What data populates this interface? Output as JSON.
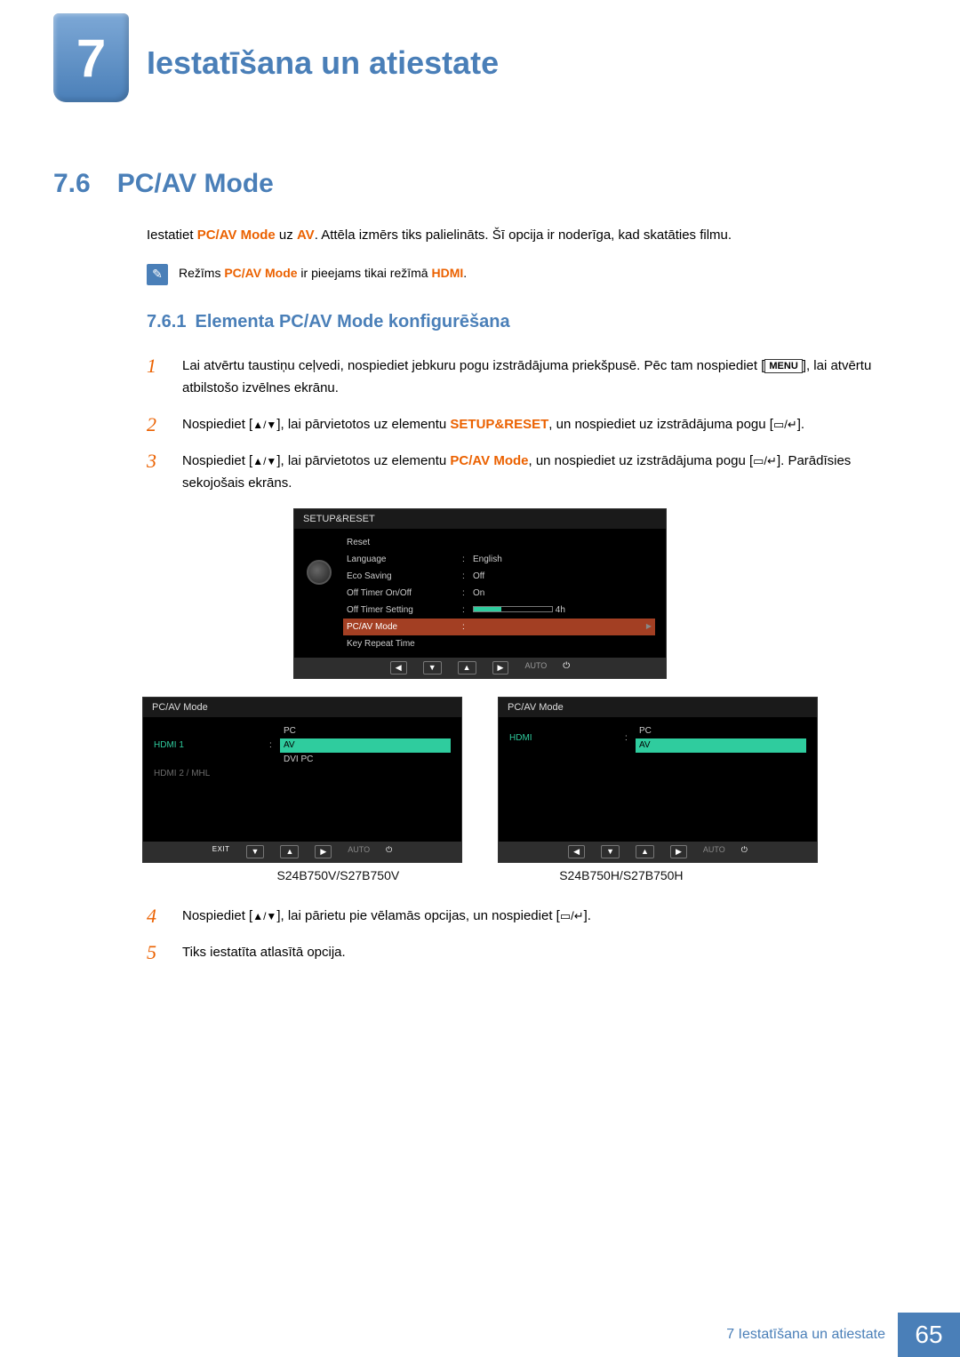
{
  "chapter": {
    "num": "7",
    "title": "Iestatīšana un atiestate"
  },
  "section": {
    "num": "7.6",
    "title": "PC/AV Mode"
  },
  "intro": {
    "prefix": "Iestatiet ",
    "mode": "PC/AV Mode",
    "mid": " uz ",
    "value": "AV",
    "suffix": ". Attēla izmērs tiks palielināts. Šī opcija ir noderīga, kad skatāties filmu."
  },
  "note": {
    "prefix": "Režīms ",
    "mode": "PC/AV Mode",
    "mid": " ir pieejams tikai režīmā ",
    "value": "HDMI",
    "suffix": "."
  },
  "subsection": {
    "num": "7.6.1",
    "title": "Elementa PC/AV Mode konfigurēšana"
  },
  "steps": {
    "s1a": "Lai atvērtu taustiņu ceļvedi, nospiediet jebkuru pogu izstrādājuma priekšpusē. Pēc tam nospiediet [",
    "s1_menu": "MENU",
    "s1b": "], lai atvērtu atbilstošo izvēlnes ekrānu.",
    "s2a": "Nospiediet [",
    "s2_arrows": "▲/▼",
    "s2b": "], lai pārvietotos uz elementu ",
    "s2_target": "SETUP&RESET",
    "s2c": ", un nospiediet uz izstrādājuma pogu [",
    "s2_enter": "▭/↵",
    "s2d": "].",
    "s3a": "Nospiediet [",
    "s3b": "], lai pārvietotos uz elementu ",
    "s3_target": "PC/AV Mode",
    "s3c": ", un nospiediet uz izstrādājuma pogu [",
    "s3d": "]. Parādīsies sekojošais ekrāns.",
    "s4a": "Nospiediet [",
    "s4b": "], lai pārietu pie vēlamās opcijas, un nospiediet [",
    "s4c": "].",
    "s5": "Tiks iestatīta atlasītā opcija."
  },
  "osd_main": {
    "title": "SETUP&RESET",
    "items": [
      {
        "label": "Reset",
        "value": ""
      },
      {
        "label": "Language",
        "value": "English"
      },
      {
        "label": "Eco Saving",
        "value": "Off"
      },
      {
        "label": "Off Timer On/Off",
        "value": "On"
      },
      {
        "label": "Off Timer Setting",
        "value": "4h",
        "slider": true
      },
      {
        "label": "PC/AV Mode",
        "value": "",
        "highlight": true
      },
      {
        "label": "Key Repeat Time",
        "value": ""
      }
    ],
    "footer": [
      "◀",
      "▼",
      "▲",
      "▶",
      "AUTO",
      "⏻"
    ]
  },
  "osd_left": {
    "title": "PC/AV Mode",
    "rows": [
      {
        "label": "HDMI 1",
        "green": true,
        "options": [
          "PC",
          "AV",
          "DVI PC"
        ],
        "highlight_index": 1
      },
      {
        "label": "HDMI 2 / MHL",
        "grey": true,
        "options": []
      }
    ],
    "footer": [
      "EXIT",
      "▼",
      "▲",
      "▶",
      "AUTO",
      "⏻"
    ]
  },
  "osd_right": {
    "title": "PC/AV Mode",
    "rows": [
      {
        "label": "HDMI",
        "green": true,
        "options": [
          "PC",
          "AV"
        ],
        "highlight_index": 1
      }
    ],
    "footer": [
      "◀",
      "▼",
      "▲",
      "▶",
      "AUTO",
      "⏻"
    ]
  },
  "models": {
    "left": "S24B750V/S27B750V",
    "right": "S24B750H/S27B750H"
  },
  "footer": {
    "label": "7 Iestatīšana un atiestate",
    "page": "65"
  }
}
